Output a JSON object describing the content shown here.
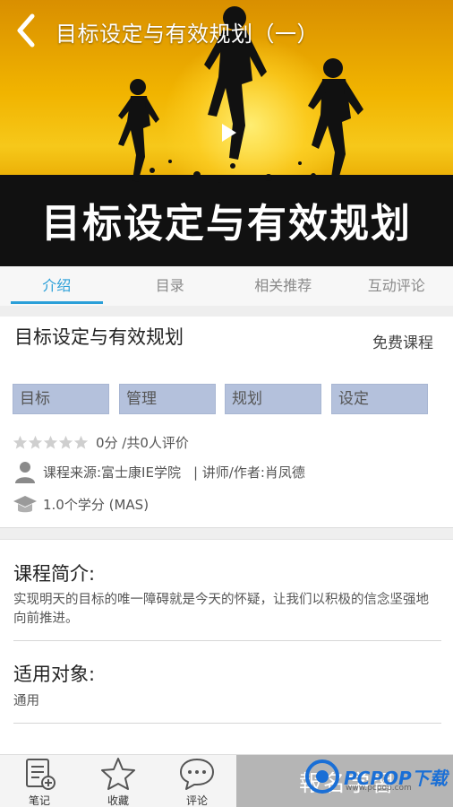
{
  "header": {
    "title": "目标设定与有效规划（一）"
  },
  "video": {
    "banner_text": "目标设定与有效规划"
  },
  "tabs": [
    {
      "label": "介绍",
      "active": true
    },
    {
      "label": "目录",
      "active": false
    },
    {
      "label": "相关推荐",
      "active": false
    },
    {
      "label": "互动评论",
      "active": false
    }
  ],
  "course": {
    "title": "目标设定与有效规划",
    "type": "免费课程",
    "tags": [
      "目标",
      "管理",
      "规划",
      "设定"
    ],
    "rating": {
      "stars_filled": 0,
      "stars_total": 5,
      "text": "0分 /共0人评价"
    },
    "source": "课程来源:富士康IE学院",
    "lecturer": "| 讲师/作者:肖凤德",
    "credit": "1.0个学分 (MAS)"
  },
  "intro": {
    "heading": "课程简介:",
    "body": "实现明天的目标的唯一障碍就是今天的怀疑，让我们以积极的信念坚强地向前推进。"
  },
  "audience": {
    "heading": "适用对象:",
    "body": "通用"
  },
  "bottom_bar": {
    "notes_label": "笔记",
    "favorite_label": "收藏",
    "comment_label": "评论",
    "join_label": "報名学習"
  },
  "watermark": {
    "brand": "PCPOP下载",
    "sub": "www.pcpop.com"
  },
  "colors": {
    "accent": "#2a9fd8",
    "tag_bg": "#b4c1dc",
    "join_bg": "#b5b5b5"
  }
}
